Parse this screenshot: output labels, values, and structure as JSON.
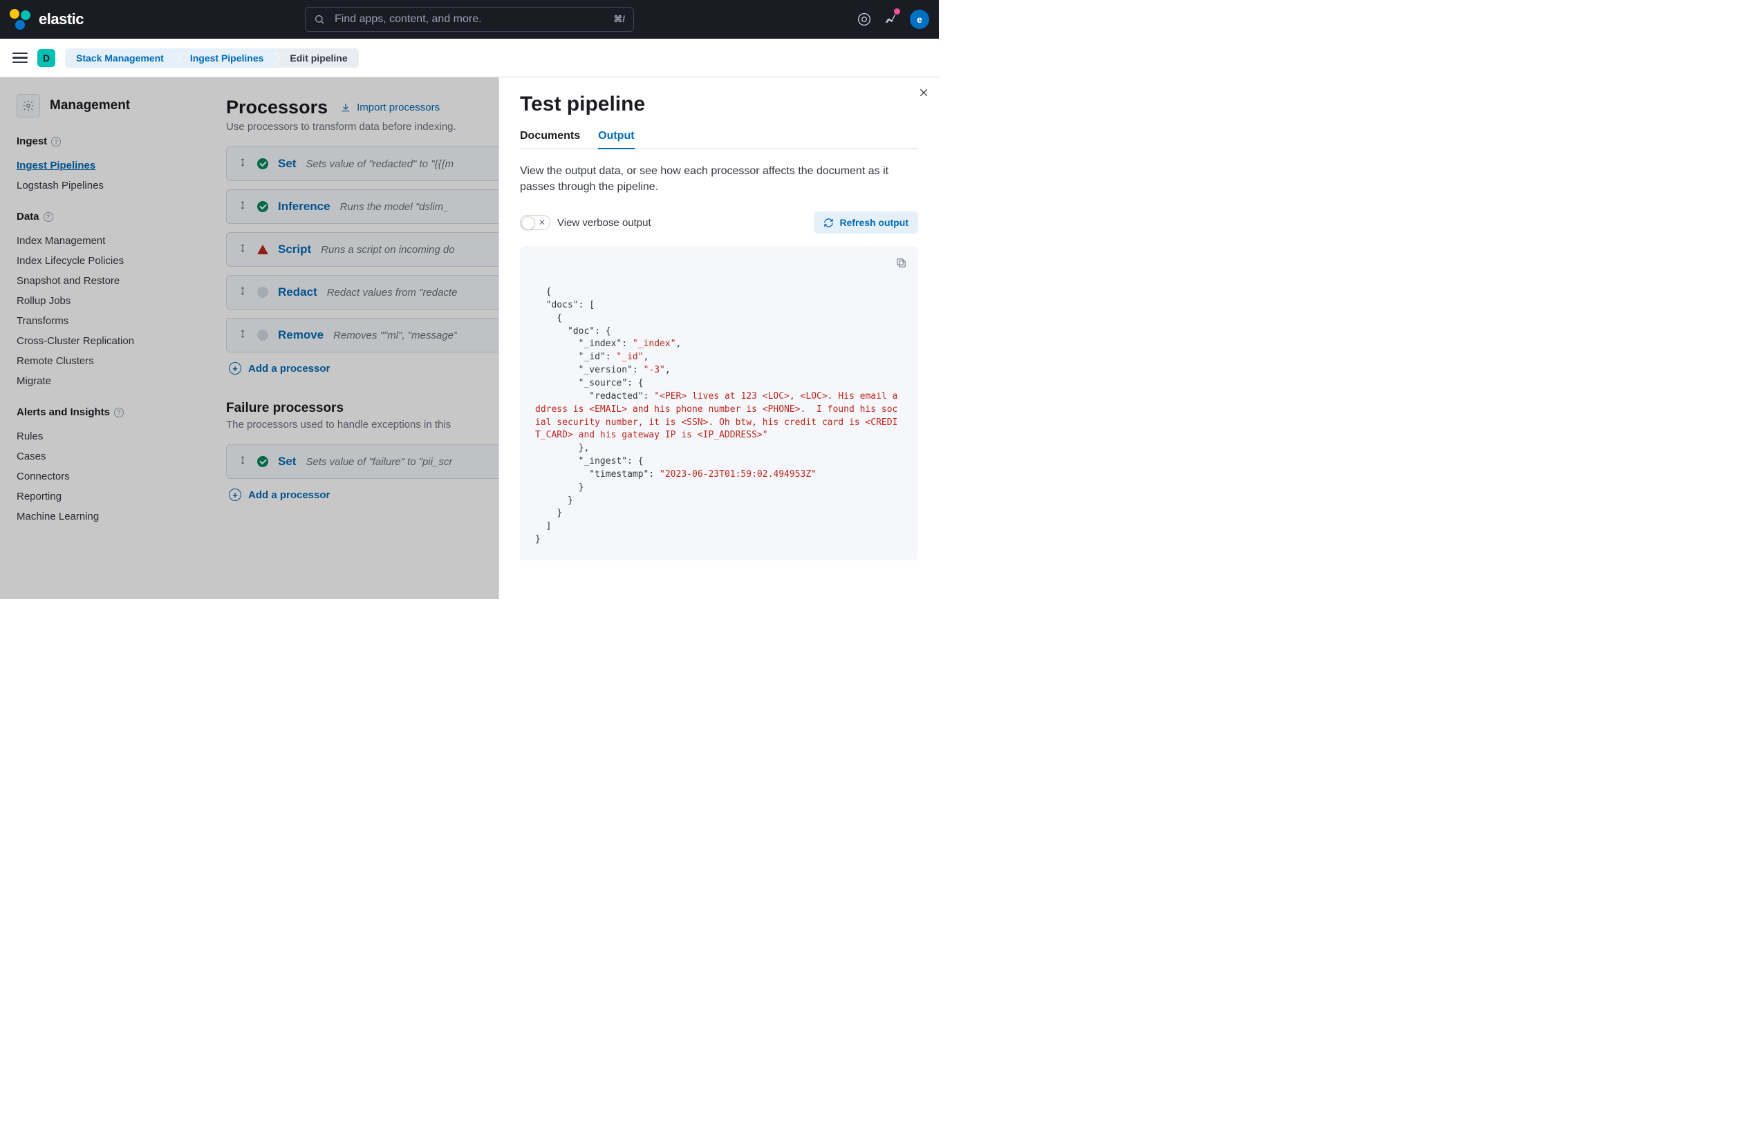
{
  "topbar": {
    "brand": "elastic",
    "search_placeholder": "Find apps, content, and more.",
    "search_shortcut": "⌘/",
    "avatar_initial": "e"
  },
  "subbar": {
    "space_initial": "D",
    "breadcrumbs": [
      {
        "label": "Stack Management",
        "link": true
      },
      {
        "label": "Ingest Pipelines",
        "link": true
      },
      {
        "label": "Edit pipeline",
        "link": false
      }
    ]
  },
  "sidebar": {
    "title": "Management",
    "groups": [
      {
        "heading": "Ingest",
        "help": true,
        "items": [
          {
            "label": "Ingest Pipelines",
            "active": true
          },
          {
            "label": "Logstash Pipelines"
          }
        ]
      },
      {
        "heading": "Data",
        "help": true,
        "items": [
          {
            "label": "Index Management"
          },
          {
            "label": "Index Lifecycle Policies"
          },
          {
            "label": "Snapshot and Restore"
          },
          {
            "label": "Rollup Jobs"
          },
          {
            "label": "Transforms"
          },
          {
            "label": "Cross-Cluster Replication"
          },
          {
            "label": "Remote Clusters"
          },
          {
            "label": "Migrate"
          }
        ]
      },
      {
        "heading": "Alerts and Insights",
        "help": true,
        "items": [
          {
            "label": "Rules"
          },
          {
            "label": "Cases"
          },
          {
            "label": "Connectors"
          },
          {
            "label": "Reporting"
          },
          {
            "label": "Machine Learning"
          }
        ]
      }
    ]
  },
  "workspace": {
    "title": "Processors",
    "import_label": "Import processors",
    "subtitle": "Use processors to transform data before indexing.",
    "processors": [
      {
        "status": "ok",
        "name": "Set",
        "desc": "Sets value of \"redacted\" to \"{{{m"
      },
      {
        "status": "ok",
        "name": "Inference",
        "desc": "Runs the model \"dslim_"
      },
      {
        "status": "warn",
        "name": "Script",
        "desc": "Runs a script on incoming do"
      },
      {
        "status": "idle",
        "name": "Redact",
        "desc": "Redact values from \"redacte"
      },
      {
        "status": "idle",
        "name": "Remove",
        "desc": "Removes \"\"ml\", \"message\""
      }
    ],
    "add_processor": "Add a processor",
    "failure_title": "Failure processors",
    "failure_subtitle": "The processors used to handle exceptions in this",
    "failure_processors": [
      {
        "status": "ok",
        "name": "Set",
        "desc": "Sets value of \"failure\" to \"pii_scr"
      }
    ]
  },
  "flyout": {
    "title": "Test pipeline",
    "tabs": [
      {
        "label": "Documents",
        "active": false
      },
      {
        "label": "Output",
        "active": true
      }
    ],
    "description": "View the output data, or see how each processor affects the document as it passes through the pipeline.",
    "toggle_label": "View verbose output",
    "refresh_label": "Refresh output",
    "output": {
      "index": "_index",
      "id": "_id",
      "version": "-3",
      "redacted": "<PER> lives at 123 <LOC>, <LOC>. His email address is <EMAIL> and his phone number is <PHONE>.  I found his social security number, it is <SSN>. Oh btw, his credit card is <CREDIT_CARD> and his gateway IP is <IP_ADDRESS>",
      "timestamp": "2023-06-23T01:59:02.494953Z"
    }
  }
}
